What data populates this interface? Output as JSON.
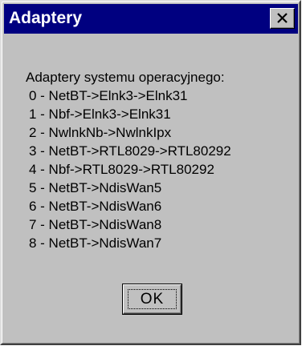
{
  "window": {
    "title": "Adaptery"
  },
  "icons": {
    "close": "close-icon"
  },
  "colors": {
    "titlebar": "#000080",
    "face": "#c0c0c0"
  },
  "content": {
    "heading": "Adaptery systemu operacyjnego:",
    "adapters": [
      "0 - NetBT->Elnk3->Elnk31",
      "1 - Nbf->Elnk3->Elnk31",
      "2 - NwlnkNb->NwlnkIpx",
      "3 - NetBT->RTL8029->RTL80292",
      "4 - Nbf->RTL8029->RTL80292",
      "5 - NetBT->NdisWan5",
      "6 - NetBT->NdisWan6",
      "7 - NetBT->NdisWan8",
      "8 - NetBT->NdisWan7"
    ]
  },
  "buttons": {
    "ok_label": "OK"
  }
}
